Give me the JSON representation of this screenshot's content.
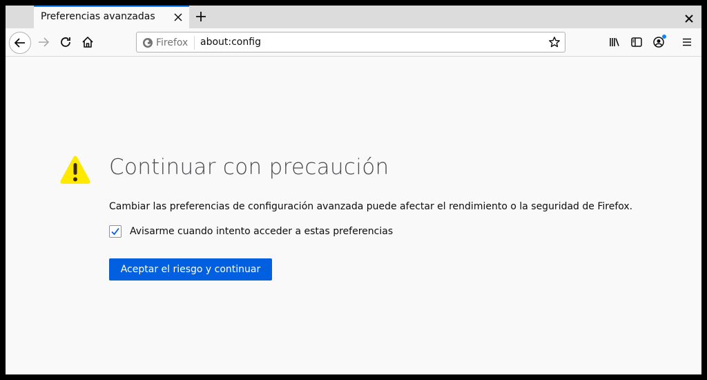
{
  "tab": {
    "title": "Preferencias avanzadas"
  },
  "urlbar": {
    "identity_label": "Firefox",
    "url": "about:config"
  },
  "toolbar": {
    "icons": [
      "back-icon",
      "forward-icon",
      "reload-icon",
      "home-icon",
      "bookmark-star-icon",
      "library-icon",
      "sidebar-icon",
      "account-icon",
      "menu-icon"
    ]
  },
  "page": {
    "title": "Continuar con precaución",
    "description": "Cambiar las preferencias de configuración avanzada puede afectar el rendimiento o la seguridad de Firefox.",
    "checkbox_label": "Avisarme cuando intento acceder a estas preferencias",
    "checkbox_checked": true,
    "accept_button": "Aceptar el riesgo y continuar"
  },
  "colors": {
    "accent": "#0060df",
    "tab_highlight": "#0a84ff",
    "warning": "#ffe900"
  }
}
